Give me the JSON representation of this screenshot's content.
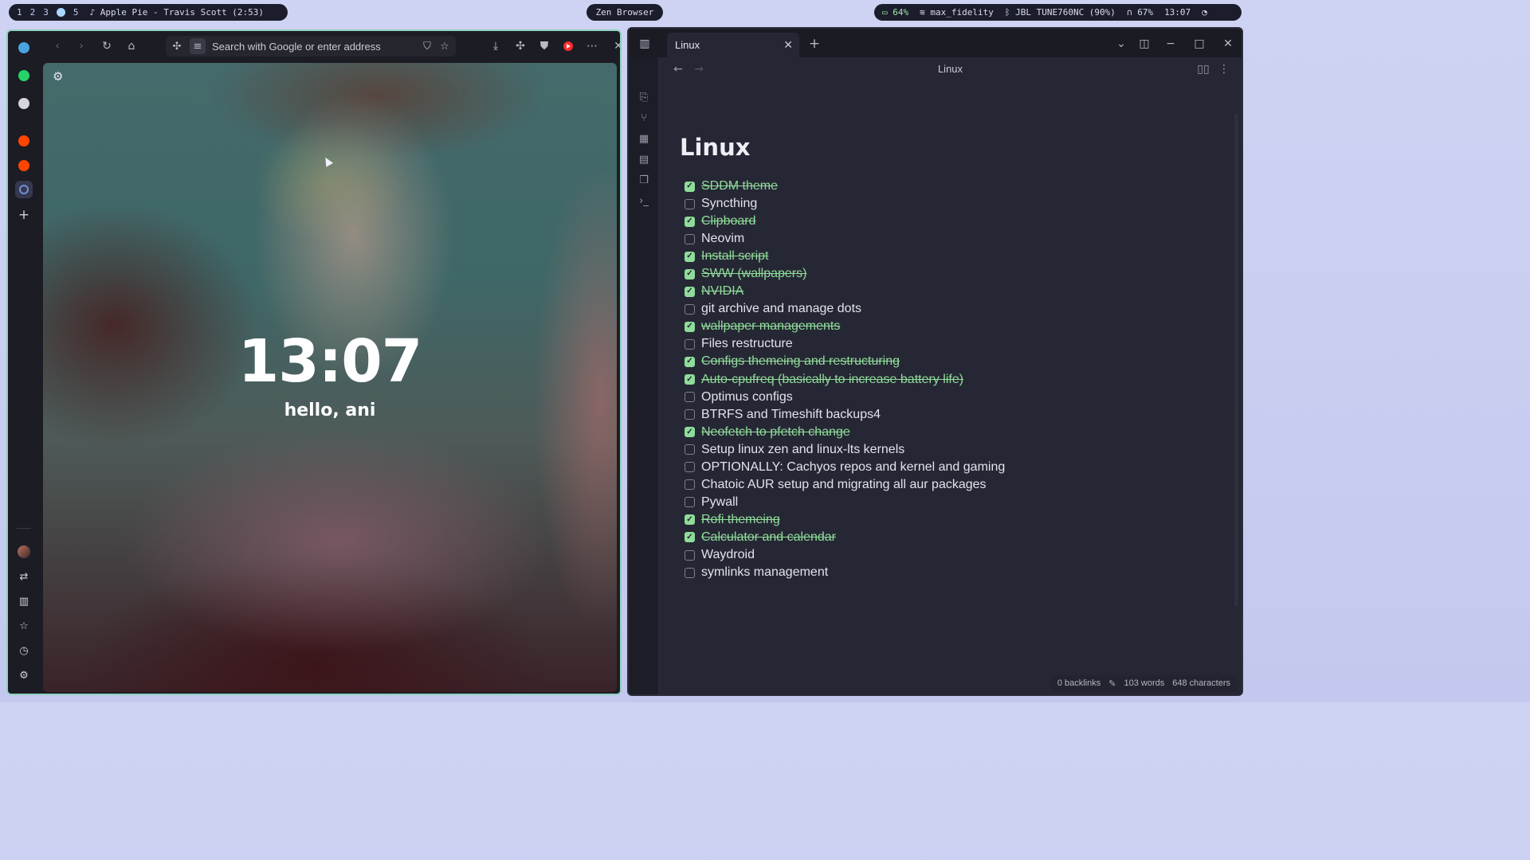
{
  "topbar": {
    "workspaces": [
      "1",
      "2",
      "3",
      "5"
    ],
    "now_playing": "♪ Apple Pie - Travis Scott (2:53)",
    "center_title": "Zen Browser",
    "battery": "64%",
    "wifi": "max_fidelity",
    "bluetooth": "JBL TUNE760NC (90%)",
    "volume": "67%",
    "time": "13:07"
  },
  "browser": {
    "search_placeholder": "Search with Google or enter address",
    "clock": "13:07",
    "greeting": "hello, ani"
  },
  "obsidian": {
    "tab_title": "Linux",
    "nav_title": "Linux",
    "note_title": "Linux",
    "checklist": [
      {
        "text": "SDDM theme",
        "done": true
      },
      {
        "text": "Syncthing",
        "done": false
      },
      {
        "text": "Clipboard",
        "done": true
      },
      {
        "text": "Neovim",
        "done": false
      },
      {
        "text": "Install script",
        "done": true
      },
      {
        "text": "SWW (wallpapers)",
        "done": true
      },
      {
        "text": "NVIDIA ",
        "done": true
      },
      {
        "text": "git archive and manage dots",
        "done": false
      },
      {
        "text": "wallpaper managements",
        "done": true
      },
      {
        "text": "Files restructure",
        "done": false
      },
      {
        "text": "Configs themeing and restructuring",
        "done": true
      },
      {
        "text": "Auto-cpufreq (basically to increase battery life)",
        "done": true
      },
      {
        "text": "Optimus configs",
        "done": false
      },
      {
        "text": "BTRFS and Timeshift backups4",
        "done": false
      },
      {
        "text": "Neofetch to pfetch change",
        "done": true
      },
      {
        "text": "Setup linux zen and linux-lts kernels",
        "done": false
      },
      {
        "text": "OPTIONALLY: Cachyos repos and kernel and gaming",
        "done": false
      },
      {
        "text": "Chatoic AUR setup and migrating all aur packages",
        "done": false
      },
      {
        "text": "Pywall",
        "done": false
      },
      {
        "text": "Rofi themeing",
        "done": true
      },
      {
        "text": "Calculator and calendar",
        "done": true
      },
      {
        "text": "Waydroid",
        "done": false
      },
      {
        "text": "symlinks management",
        "done": false
      }
    ],
    "status": {
      "backlinks": "0 backlinks",
      "words": "103 words",
      "characters": "648 characters"
    }
  }
}
